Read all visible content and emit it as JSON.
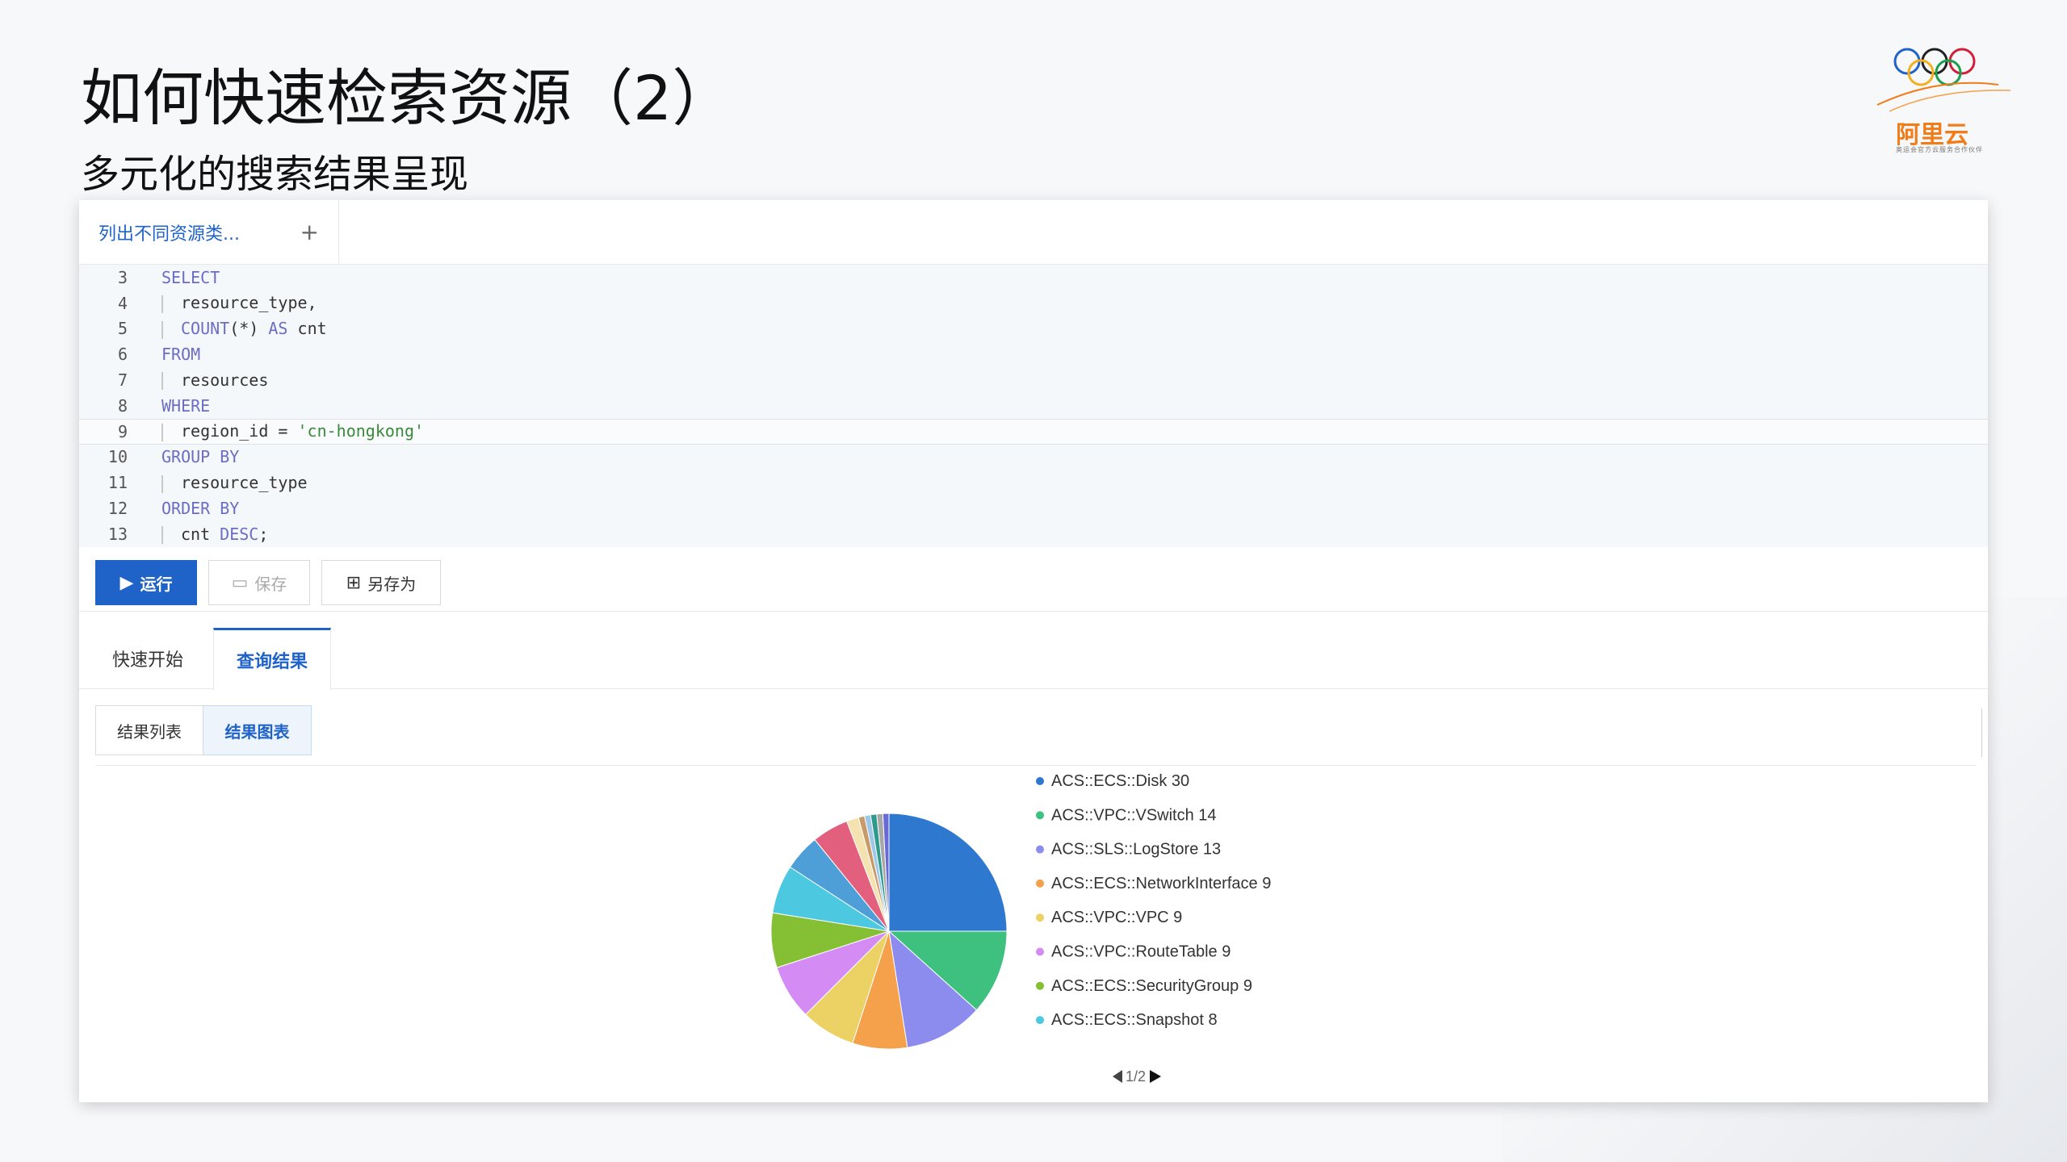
{
  "slide": {
    "title": "如何快速检索资源（2）",
    "subtitle": "多元化的搜索结果呈现"
  },
  "logo": {
    "brand": "阿里云",
    "slogan": "奥运会官方云服务合作伙伴"
  },
  "query_tab": {
    "label": "列出不同资源类...",
    "add_label": "+"
  },
  "editor": {
    "lines": [
      {
        "n": "3",
        "kind": "kw",
        "text": "SELECT"
      },
      {
        "n": "4",
        "kind": "ind",
        "text": "resource_type,"
      },
      {
        "n": "5",
        "kind": "ind-mix",
        "a": "COUNT",
        "b": "(*) ",
        "c": "AS",
        "d": " cnt"
      },
      {
        "n": "6",
        "kind": "kw",
        "text": "FROM"
      },
      {
        "n": "7",
        "kind": "ind",
        "text": "resources"
      },
      {
        "n": "8",
        "kind": "kw",
        "text": "WHERE"
      },
      {
        "n": "9",
        "kind": "ind-str",
        "a": "region_id = ",
        "b": "'cn-hongkong'"
      },
      {
        "n": "10",
        "kind": "kw",
        "text": "GROUP BY"
      },
      {
        "n": "11",
        "kind": "ind",
        "text": "resource_type"
      },
      {
        "n": "12",
        "kind": "kw",
        "text": "ORDER BY"
      },
      {
        "n": "13",
        "kind": "ind-desc",
        "a": "cnt ",
        "b": "DESC",
        "c": ";"
      }
    ]
  },
  "toolbar": {
    "run_label": "运行",
    "save_label": "保存",
    "saveas_label": "另存为"
  },
  "result_tabs": {
    "quick_start": "快速开始",
    "query_result": "查询结果"
  },
  "view_tabs": {
    "list": "结果列表",
    "chart": "结果图表"
  },
  "chart_data": {
    "type": "pie",
    "legend": [
      {
        "label": "ACS::ECS::Disk",
        "value": 30,
        "color": "#2f78d0"
      },
      {
        "label": "ACS::VPC::VSwitch",
        "value": 14,
        "color": "#3ec07e"
      },
      {
        "label": "ACS::SLS::LogStore",
        "value": 13,
        "color": "#8c8cef"
      },
      {
        "label": "ACS::ECS::NetworkInterface",
        "value": 9,
        "color": "#f5a04a"
      },
      {
        "label": "ACS::VPC::VPC",
        "value": 9,
        "color": "#ecd165"
      },
      {
        "label": "ACS::VPC::RouteTable",
        "value": 9,
        "color": "#d48bf4"
      },
      {
        "label": "ACS::ECS::SecurityGroup",
        "value": 9,
        "color": "#85bf34"
      },
      {
        "label": "ACS::ECS::Snapshot",
        "value": 8,
        "color": "#4cc9e0"
      }
    ],
    "hidden_slices": [
      {
        "value": 6,
        "color": "#4e9fd8"
      },
      {
        "value": 6,
        "color": "#e25f7e"
      },
      {
        "value": 2,
        "color": "#f4e3b0"
      },
      {
        "value": 1,
        "color": "#c89a6a"
      },
      {
        "value": 1,
        "color": "#9ec8e8"
      },
      {
        "value": 1,
        "color": "#2f9a8c"
      },
      {
        "value": 1,
        "color": "#a8a8a8"
      },
      {
        "value": 1,
        "color": "#6a6ad6"
      }
    ],
    "pager": "1/2"
  }
}
